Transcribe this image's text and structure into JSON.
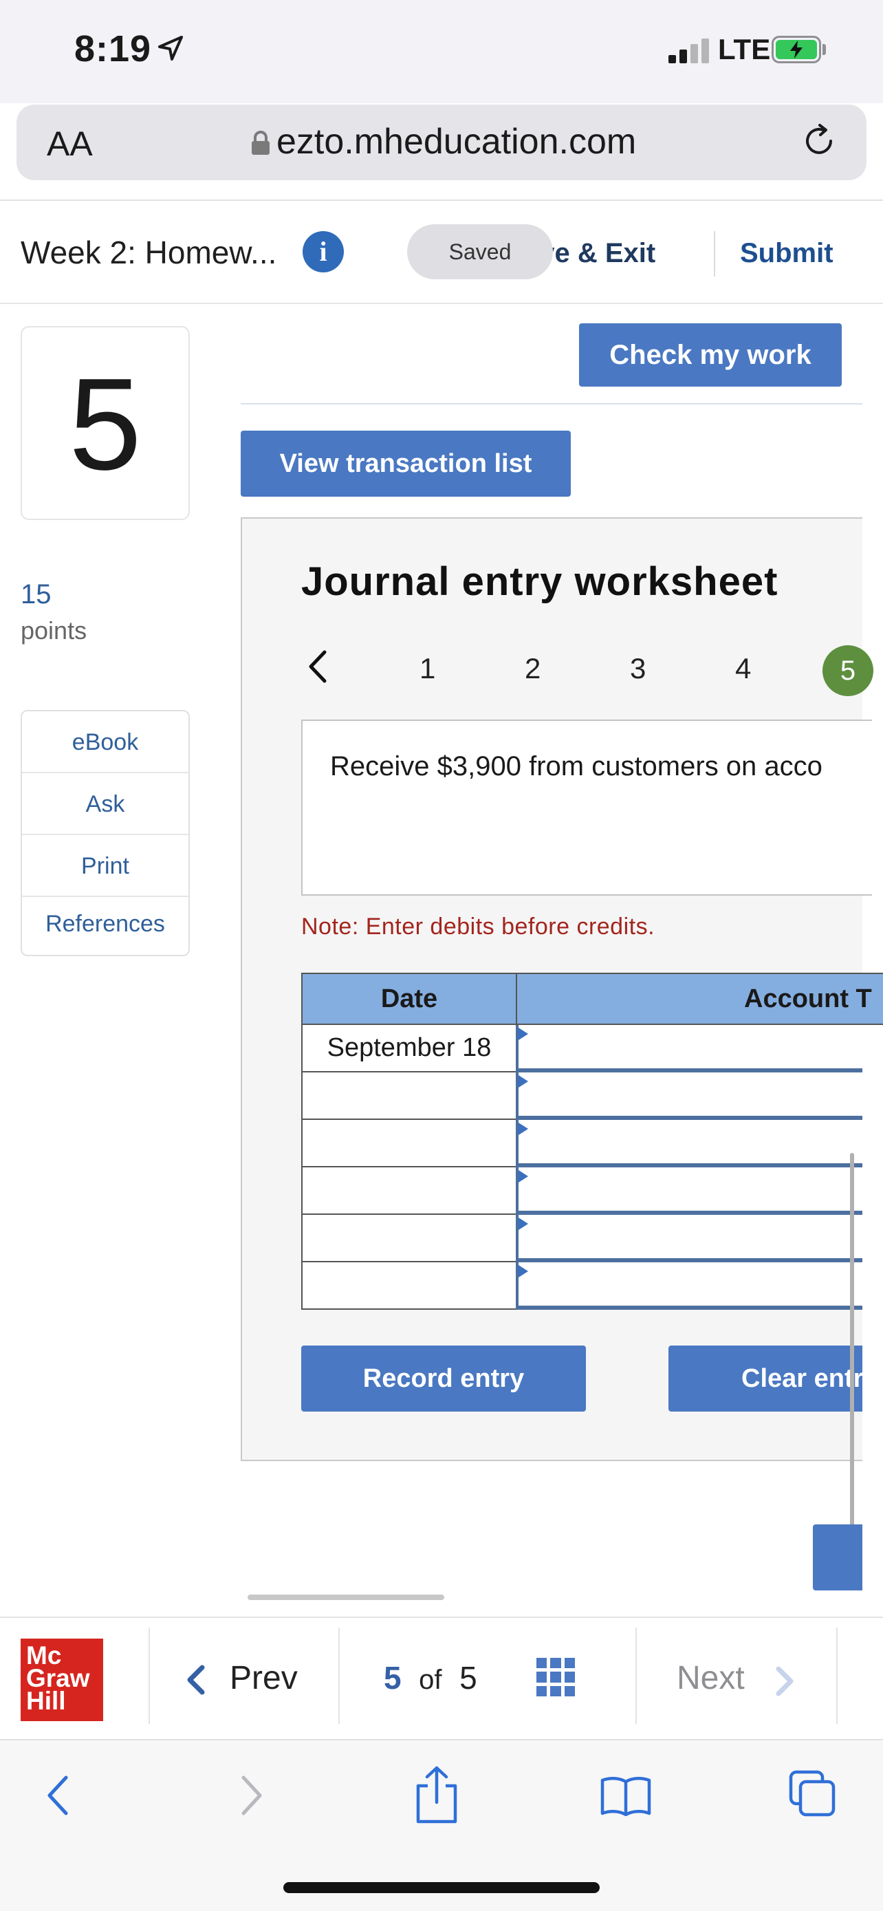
{
  "status_bar": {
    "time": "8:19",
    "network": "LTE",
    "location_icon": "location-arrow-icon",
    "battery_icon": "battery-charging-icon"
  },
  "browser": {
    "text_size_label": "AA",
    "url": "ezto.mheducation.com",
    "lock_icon": "lock-icon",
    "reload_icon": "reload-icon"
  },
  "header": {
    "assignment_title": "Week 2: Homew...",
    "info_icon": "info-icon",
    "saved_label": "Saved",
    "save_exit_label": "ave & Exit",
    "submit_label": "Submit"
  },
  "sidebar": {
    "question_number": "5",
    "points_value": "15",
    "points_label": "points",
    "links": [
      "eBook",
      "Ask",
      "Print",
      "References"
    ]
  },
  "main": {
    "check_work_label": "Check my work",
    "view_transactions_label": "View transaction list",
    "worksheet": {
      "title": "Journal entry worksheet",
      "pages": [
        "1",
        "2",
        "3",
        "4",
        "5"
      ],
      "active_page": "5",
      "description": "Receive $3,900 from customers on acco",
      "note": "Note: Enter debits before credits.",
      "table": {
        "headers": {
          "date": "Date",
          "account": "Account T"
        },
        "rows": [
          {
            "date": "September 18",
            "account": ""
          },
          {
            "date": "",
            "account": ""
          },
          {
            "date": "",
            "account": ""
          },
          {
            "date": "",
            "account": ""
          },
          {
            "date": "",
            "account": ""
          },
          {
            "date": "",
            "account": ""
          }
        ]
      },
      "record_label": "Record entry",
      "clear_label": "Clear entr"
    }
  },
  "bottom_nav": {
    "logo_lines": [
      "Mc",
      "Graw",
      "Hill"
    ],
    "prev_label": "Prev",
    "current_page": "5",
    "of_label": "of",
    "total_pages": "5",
    "next_label": "Next"
  },
  "colors": {
    "primary_button": "#4a78c2",
    "table_header": "#85aee0",
    "active_page": "#5d8f3e",
    "note_text": "#a3251d",
    "logo_red": "#d6251f"
  }
}
